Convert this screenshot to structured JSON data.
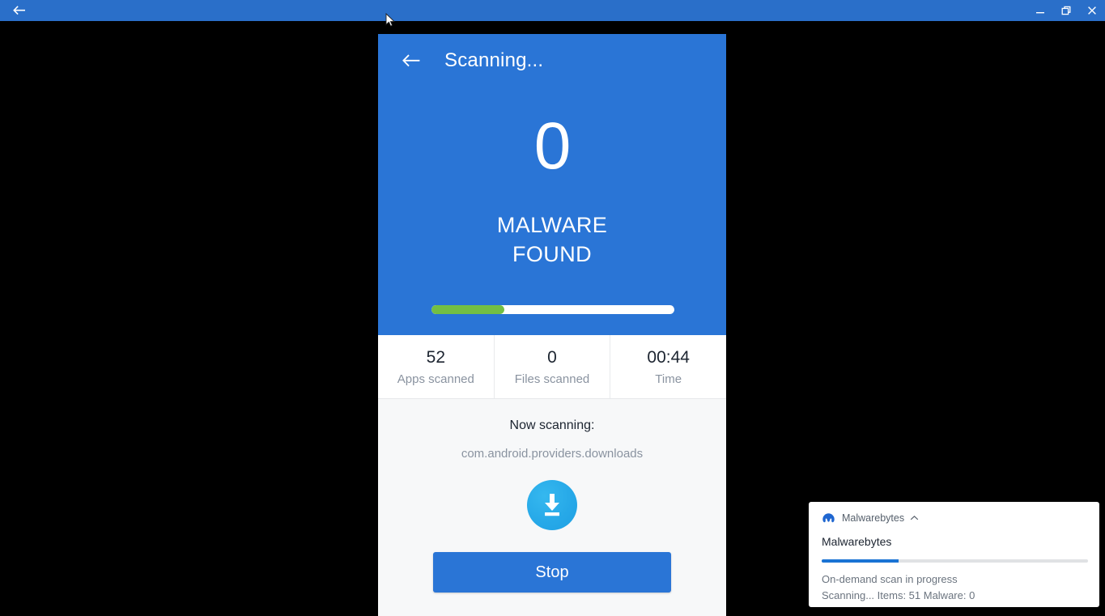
{
  "window": {
    "back_icon": "arrow-left-icon",
    "controls": {
      "minimize": "minimize-icon",
      "restore": "restore-icon",
      "close": "close-icon"
    },
    "titlebar_color": "#2a6fc9"
  },
  "app": {
    "header": {
      "back_icon": "arrow-left-icon",
      "title": "Scanning...",
      "background_color": "#2a75d6"
    },
    "result": {
      "count": "0",
      "label_line1": "MALWARE",
      "label_line2": "FOUND"
    },
    "progress": {
      "percent": 30,
      "fill_color": "#73bf44",
      "track_color": "#ffffff"
    },
    "stats": [
      {
        "value": "52",
        "label": "Apps scanned"
      },
      {
        "value": "0",
        "label": "Files scanned"
      },
      {
        "value": "00:44",
        "label": "Time"
      }
    ],
    "scanning": {
      "label": "Now scanning:",
      "target": "com.android.providers.downloads",
      "icon": "download-icon"
    },
    "stop_button": "Stop"
  },
  "notification": {
    "logo_icon": "malwarebytes-logo-icon",
    "app_name": "Malwarebytes",
    "collapse_icon": "chevron-up-icon",
    "title": "Malwarebytes",
    "progress": {
      "percent": 29,
      "fill_color": "#1a73d4",
      "track_color": "#e0e2e4"
    },
    "status_line1": "On-demand scan in progress",
    "status_line2": "Scanning... Items: 51 Malware: 0"
  },
  "cursor": {
    "icon": "mouse-pointer-icon"
  }
}
